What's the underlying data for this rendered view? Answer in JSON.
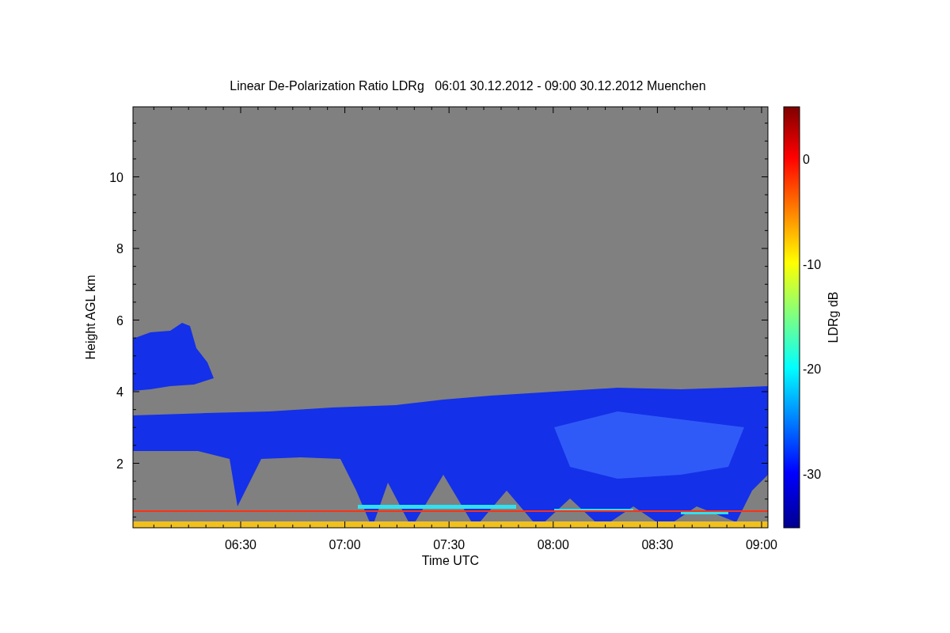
{
  "figure": {
    "title": "Linear De-Polarization Ratio LDRg   06:01 30.12.2012 - 09:00 30.12.2012 Muenchen",
    "xlabel": "Time UTC",
    "ylabel": "Height AGL km",
    "xticks": [
      "06:30",
      "07:00",
      "07:30",
      "08:00",
      "08:30",
      "09:00"
    ],
    "yticks": [
      "10",
      "8",
      "6",
      "4",
      "2"
    ],
    "colorbar": {
      "label": "LDRg dB",
      "ticks": [
        "0",
        "-10",
        "-20",
        "-30"
      ]
    }
  }
}
